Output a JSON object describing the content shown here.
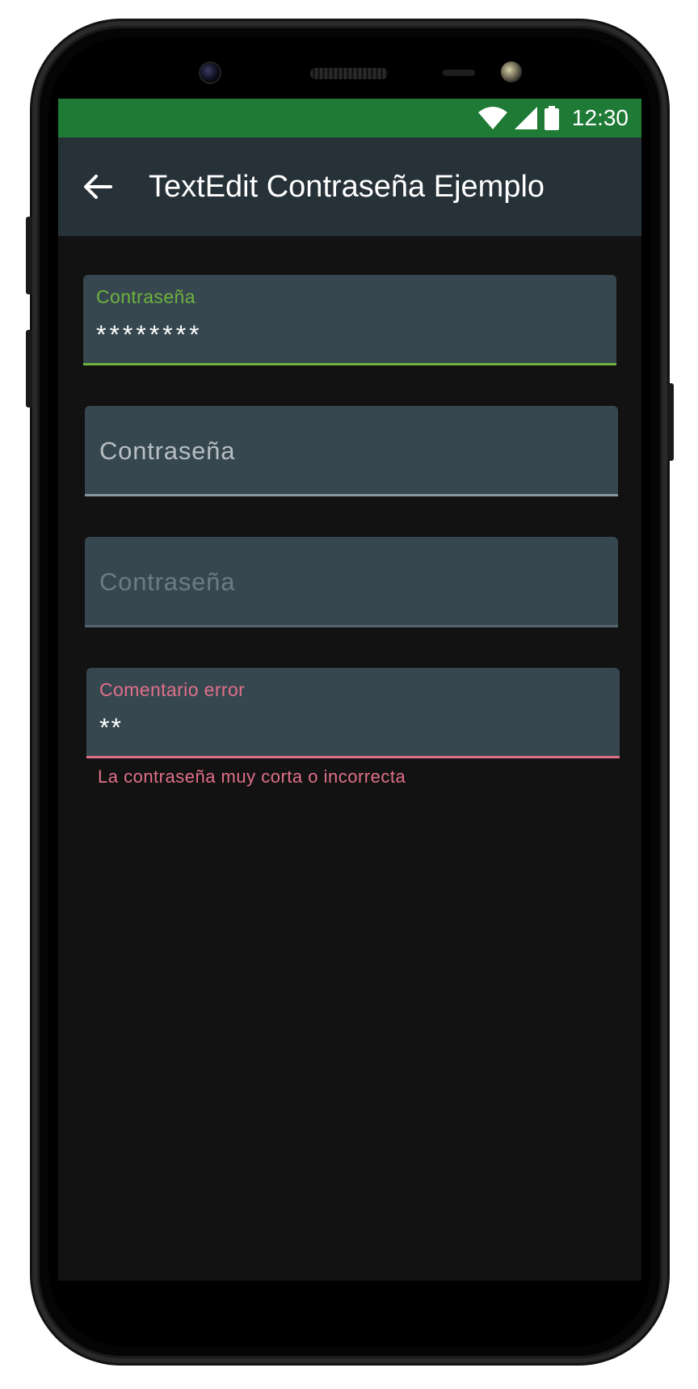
{
  "status_bar": {
    "time": "12:30",
    "icons": [
      "wifi-icon",
      "cellular-signal-icon",
      "battery-icon"
    ],
    "background_color": "#1e7a35"
  },
  "app_bar": {
    "back_icon": "arrow-left-icon",
    "title": "TextEdit Contraseña Ejemplo",
    "background_color": "#263238"
  },
  "fields": [
    {
      "label": "Contraseña",
      "value": "********",
      "state": "focused",
      "accent_color": "#6db33f"
    },
    {
      "label": "Contraseña",
      "value": "",
      "state": "enabled"
    },
    {
      "label": "Contraseña",
      "value": "",
      "state": "disabled"
    },
    {
      "label": "Comentario error",
      "value": "**",
      "state": "error",
      "error_text": "La contraseña muy corta o incorrecta",
      "accent_color": "#e0708a"
    }
  ],
  "colors": {
    "screen_background": "#121212",
    "field_background": "#37474f"
  }
}
